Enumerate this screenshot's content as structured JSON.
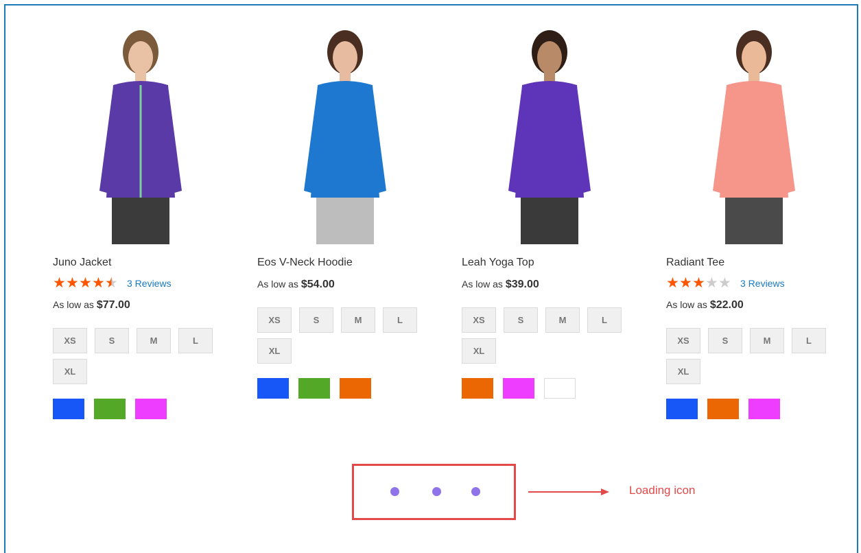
{
  "products": [
    {
      "name": "Juno Jacket",
      "rating_filled": 4.5,
      "rating_max": 5,
      "reviews": "3  Reviews",
      "price_prefix": "As low as",
      "price": "$77.00",
      "sizes": [
        "XS",
        "S",
        "M",
        "L",
        "XL"
      ],
      "swatches": [
        "#1857f7",
        "#53a828",
        "#ef3dff"
      ],
      "image": {
        "top": "#7a5a3a",
        "garment": "#5a3aa6",
        "accent": "#7ecf9e",
        "skin": "#e9c2a6",
        "legs": "#3b3b3b"
      }
    },
    {
      "name": "Eos V-Neck Hoodie",
      "rating_filled": null,
      "reviews": null,
      "price_prefix": "As low as",
      "price": "$54.00",
      "sizes": [
        "XS",
        "S",
        "M",
        "L",
        "XL"
      ],
      "swatches": [
        "#1857f7",
        "#53a828",
        "#eb6703"
      ],
      "image": {
        "top": "#4a2e22",
        "garment": "#1f78d0",
        "accent": "#1f78d0",
        "skin": "#e7bba0",
        "legs": "#bdbdbd"
      }
    },
    {
      "name": "Leah Yoga Top",
      "rating_filled": null,
      "reviews": null,
      "price_prefix": "As low as",
      "price": "$39.00",
      "sizes": [
        "XS",
        "S",
        "M",
        "L",
        "XL"
      ],
      "swatches": [
        "#eb6703",
        "#ef3dff",
        "#ffffff"
      ],
      "image": {
        "top": "#2e1e16",
        "garment": "#5e35b8",
        "accent": "#5e35b8",
        "skin": "#b98a68",
        "legs": "#3a3a3a"
      }
    },
    {
      "name": "Radiant Tee",
      "rating_filled": 3,
      "rating_max": 5,
      "reviews": "3  Reviews",
      "price_prefix": "As low as",
      "price": "$22.00",
      "sizes": [
        "XS",
        "S",
        "M",
        "L",
        "XL"
      ],
      "swatches": [
        "#1857f7",
        "#eb6703",
        "#ef3dff"
      ],
      "image": {
        "top": "#4a2e22",
        "garment": "#f6958a",
        "accent": "#f6958a",
        "skin": "#e9b998",
        "legs": "#4a4a4a"
      }
    }
  ],
  "loader": {
    "dots": 3,
    "dot_color": "#8f73e8",
    "box_color": "#e34949"
  },
  "annotation": {
    "label": "Loading icon",
    "color": "#e34949"
  }
}
